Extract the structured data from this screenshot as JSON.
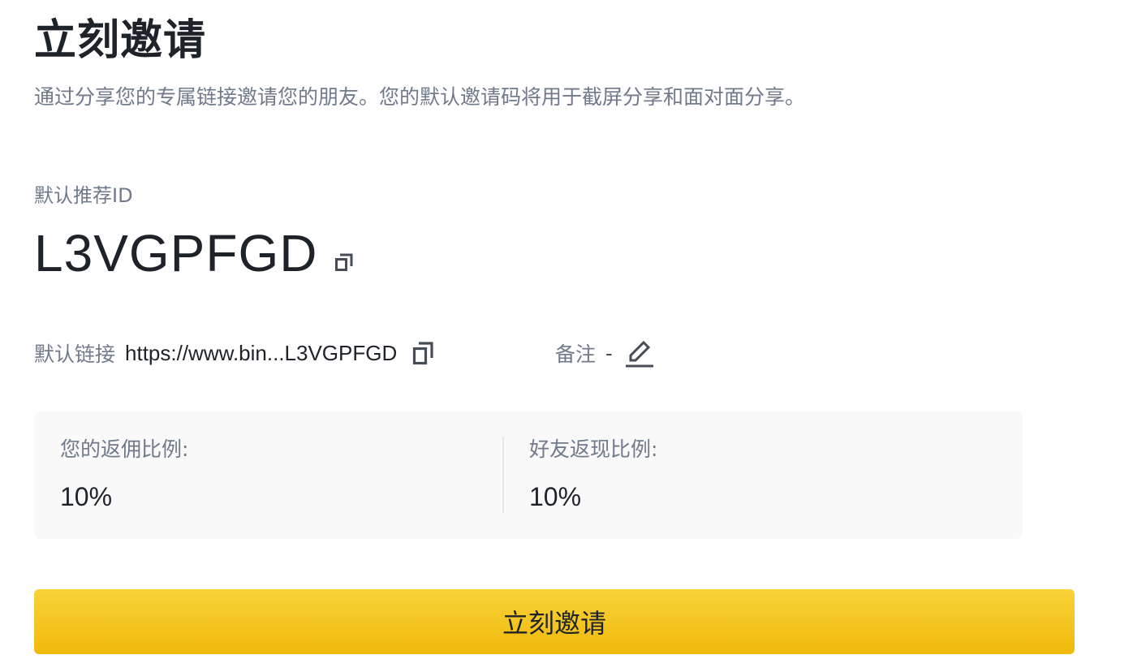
{
  "header": {
    "title": "立刻邀请",
    "subtitle": "通过分享您的专属链接邀请您的朋友。您的默认邀请码将用于截屏分享和面对面分享。"
  },
  "referral": {
    "id_label": "默认推荐ID",
    "id_value": "L3VGPFGD",
    "copy_icon": "copy-icon"
  },
  "link": {
    "label": "默认链接",
    "value": "https://www.bin...L3VGPFGD",
    "copy_icon": "copy-icon"
  },
  "note": {
    "label": "备注",
    "value": "-",
    "edit_icon": "edit-pencil-icon"
  },
  "rates": {
    "your_commission_label": "您的返佣比例:",
    "your_commission_value": "10%",
    "friend_cashback_label": "好友返现比例:",
    "friend_cashback_value": "10%"
  },
  "actions": {
    "invite_button_label": "立刻邀请"
  },
  "colors": {
    "accent": "#F0B90B",
    "text_primary": "#1E2329",
    "text_secondary": "#707A8A",
    "panel_bg": "#F9F9F9"
  }
}
